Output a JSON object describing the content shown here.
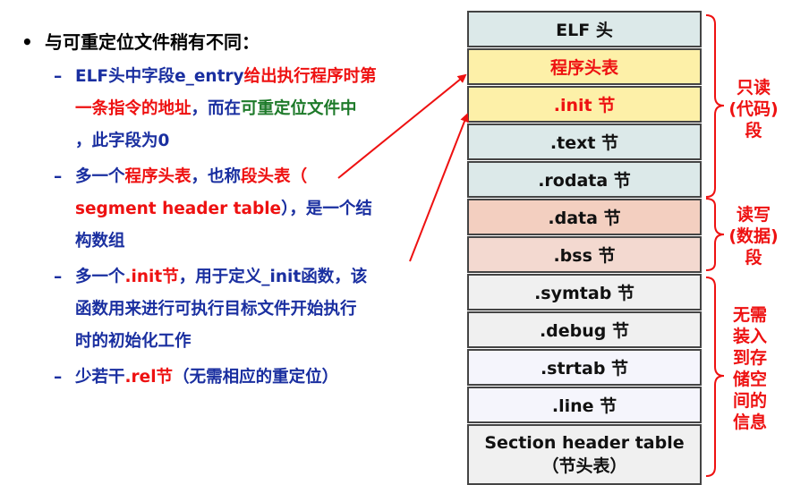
{
  "heading": "与可重定位文件稍有不同：",
  "items": [
    {
      "line1": {
        "a": "ELF头中字段e_entry",
        "b": "给出执行程序时第"
      },
      "line2": {
        "a": "一条指令的地址",
        "b": "，而在",
        "c": "可重定位文件中"
      },
      "line3": "，此字段为0"
    },
    {
      "line1": {
        "a": "多一个",
        "b": "程序头表",
        "c": "，也称",
        "d": "段头表",
        "e": "（"
      },
      "line2": {
        "a": "segment header table",
        "b": "），是一个结"
      },
      "line3": "构数组"
    },
    {
      "line1": {
        "a": "多一个",
        "b": ".init节",
        "c": "，用于定义_init函数，该"
      },
      "line2": "函数用来进行可执行目标文件开始执行",
      "line3": "时的初始化工作"
    },
    {
      "line1": {
        "a": "少若干",
        "b": ".rel节",
        "c": "（无需相应的重定位）"
      }
    }
  ],
  "sections": [
    {
      "label": "ELF 头",
      "color": "#dce9e9"
    },
    {
      "label": "程序头表",
      "color": "#fdf0a8",
      "text_color": "#ee1111"
    },
    {
      "label": ".init 节",
      "color": "#fdf0a8",
      "text_color": "#ee1111"
    },
    {
      "label": ".text 节",
      "color": "#dce9e9"
    },
    {
      "label": ".rodata 节",
      "color": "#dce9e9"
    },
    {
      "label": ".data 节",
      "color": "#f3cfc0"
    },
    {
      "label": ".bss 节",
      "color": "#f3d9d0"
    },
    {
      "label": ".symtab 节",
      "color": "#f0f0f0"
    },
    {
      "label": ".debug 节",
      "color": "#f0f0f0"
    },
    {
      "label": ".strtab 节",
      "color": "#f5f5fc"
    },
    {
      "label": ".line 节",
      "color": "#f5f5fc"
    },
    {
      "label": "Section header table",
      "label2": "（节头表）",
      "color": "#f0f0f0"
    }
  ],
  "groups": [
    {
      "lines": [
        "只读",
        "(代码)",
        "段"
      ]
    },
    {
      "lines": [
        "读写",
        "(数据)",
        "段"
      ]
    },
    {
      "lines": [
        "无需",
        "装入",
        "到存",
        "储空",
        "间的",
        "信息"
      ]
    }
  ],
  "accent_red": "#ee1111",
  "text_blue": "#1a2fa0",
  "text_green": "#1e7a2a"
}
